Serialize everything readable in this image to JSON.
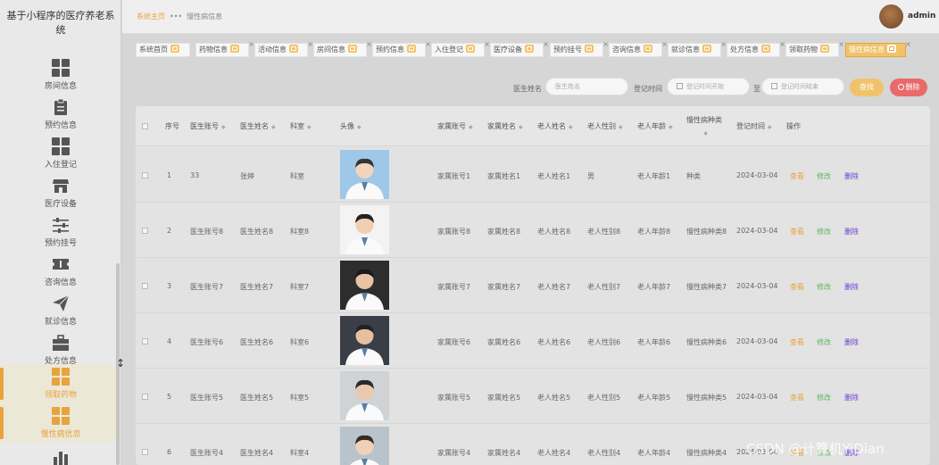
{
  "app": {
    "title": "基于小程序的医疗养老系统"
  },
  "sidebar": {
    "items": [
      {
        "label": "房间信息",
        "icon": "grid-icon",
        "active": false
      },
      {
        "label": "预约信息",
        "icon": "clipboard-icon",
        "active": false
      },
      {
        "label": "入住登记",
        "icon": "grid-icon",
        "active": false
      },
      {
        "label": "医疗设备",
        "icon": "shop-icon",
        "active": false
      },
      {
        "label": "预约挂号",
        "icon": "sliders-icon",
        "active": false
      },
      {
        "label": "咨询信息",
        "icon": "ticket-icon",
        "active": false
      },
      {
        "label": "就诊信息",
        "icon": "send-icon",
        "active": false
      },
      {
        "label": "处方信息",
        "icon": "briefcase-icon",
        "active": false
      },
      {
        "label": "领取药物",
        "icon": "grid-icon",
        "active": true
      },
      {
        "label": "慢性病信息",
        "icon": "grid-icon",
        "active": true
      }
    ]
  },
  "breadcrumb": {
    "home": "系统主页",
    "separator": "•••",
    "current": "慢性病信息"
  },
  "user": {
    "name": "admin"
  },
  "tabs": [
    {
      "label": "系统首页"
    },
    {
      "label": "药物信息"
    },
    {
      "label": "活动信息"
    },
    {
      "label": "房间信息"
    },
    {
      "label": "预约信息"
    },
    {
      "label": "入住登记"
    },
    {
      "label": "医疗设备"
    },
    {
      "label": "预约挂号"
    },
    {
      "label": "咨询信息"
    },
    {
      "label": "就诊信息"
    },
    {
      "label": "处方信息"
    },
    {
      "label": "领取药物"
    },
    {
      "label": "慢性病信息",
      "active": true
    }
  ],
  "search": {
    "name_label": "医生姓名",
    "name_placeholder": "医生姓名",
    "time_label": "登记时间",
    "start_placeholder": "登记时间开始",
    "range_sep": "至",
    "end_placeholder": "登记时间结束",
    "search_button": "查找",
    "delete_button": "删除"
  },
  "table": {
    "columns": [
      "序号",
      "医生账号",
      "医生姓名",
      "科室",
      "头像",
      "家属账号",
      "家属姓名",
      "老人姓名",
      "老人性别",
      "老人年龄",
      "慢性病种类",
      "登记时间",
      "操作"
    ],
    "actions": {
      "view": "查看",
      "edit": "修改",
      "delete": "删除"
    },
    "rows": [
      {
        "no": "1",
        "doc_account": "33",
        "doc_name": "张婷",
        "dept": "科室",
        "fam_account": "家属账号1",
        "fam_name": "家属姓名1",
        "elder_name": "老人姓名1",
        "elder_gender": "男",
        "elder_age": "老人年龄1",
        "disease": "种类",
        "time": "2024-03-04"
      },
      {
        "no": "2",
        "doc_account": "医生账号8",
        "doc_name": "医生姓名8",
        "dept": "科室8",
        "fam_account": "家属账号8",
        "fam_name": "家属姓名8",
        "elder_name": "老人姓名8",
        "elder_gender": "老人性别8",
        "elder_age": "老人年龄8",
        "disease": "慢性病种类8",
        "time": "2024-03-04"
      },
      {
        "no": "3",
        "doc_account": "医生账号7",
        "doc_name": "医生姓名7",
        "dept": "科室7",
        "fam_account": "家属账号7",
        "fam_name": "家属姓名7",
        "elder_name": "老人姓名7",
        "elder_gender": "老人性别7",
        "elder_age": "老人年龄7",
        "disease": "慢性病种类7",
        "time": "2024-03-04"
      },
      {
        "no": "4",
        "doc_account": "医生账号6",
        "doc_name": "医生姓名6",
        "dept": "科室6",
        "fam_account": "家属账号6",
        "fam_name": "家属姓名6",
        "elder_name": "老人姓名6",
        "elder_gender": "老人性别6",
        "elder_age": "老人年龄6",
        "disease": "慢性病种类6",
        "time": "2024-03-04"
      },
      {
        "no": "5",
        "doc_account": "医生账号5",
        "doc_name": "医生姓名5",
        "dept": "科室5",
        "fam_account": "家属账号5",
        "fam_name": "家属姓名5",
        "elder_name": "老人姓名5",
        "elder_gender": "老人性别5",
        "elder_age": "老人年龄5",
        "disease": "慢性病种类5",
        "time": "2024-03-04"
      },
      {
        "no": "6",
        "doc_account": "医生账号4",
        "doc_name": "医生姓名4",
        "dept": "科室4",
        "fam_account": "家属账号4",
        "fam_name": "家属姓名4",
        "elder_name": "老人姓名4",
        "elder_gender": "老人性别4",
        "elder_age": "老人年龄4",
        "disease": "慢性病种类4",
        "time": "2024-03-04"
      }
    ]
  },
  "watermark": "CSDN @计算机YiDian",
  "colors": {
    "accent": "#e8a33b",
    "danger": "#e96a6a",
    "edit": "#5cb85c",
    "delete": "#6b3fd6"
  }
}
